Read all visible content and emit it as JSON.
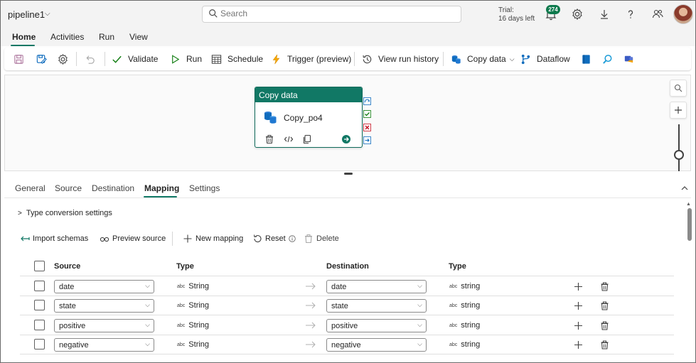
{
  "app": {
    "title": "pipeline1"
  },
  "search": {
    "placeholder": "Search"
  },
  "trial": {
    "line1": "Trial:",
    "line2": "16 days left"
  },
  "notifications": {
    "count": "274"
  },
  "menu": {
    "tabs": [
      "Home",
      "Activities",
      "Run",
      "View"
    ],
    "active": "Home"
  },
  "toolbar": {
    "validate": "Validate",
    "run": "Run",
    "schedule": "Schedule",
    "trigger": "Trigger (preview)",
    "view_run_history": "View run history",
    "copy_data": "Copy data",
    "dataflow": "Dataflow"
  },
  "activity": {
    "type": "Copy data",
    "name": "Copy_po4"
  },
  "panel": {
    "tabs": [
      "General",
      "Source",
      "Destination",
      "Mapping",
      "Settings"
    ],
    "active": "Mapping",
    "type_conversion": "Type conversion settings",
    "actions": {
      "import_schemas": "Import schemas",
      "preview_source": "Preview source",
      "new_mapping": "New mapping",
      "reset": "Reset",
      "delete": "Delete"
    }
  },
  "mapping": {
    "headers": {
      "source": "Source",
      "source_type": "Type",
      "destination": "Destination",
      "dest_type": "Type"
    },
    "abc": "abc",
    "rows": [
      {
        "source": "date",
        "source_type": "String",
        "destination": "date",
        "dest_type": "string"
      },
      {
        "source": "state",
        "source_type": "String",
        "destination": "state",
        "dest_type": "string"
      },
      {
        "source": "positive",
        "source_type": "String",
        "destination": "positive",
        "dest_type": "string"
      },
      {
        "source": "negative",
        "source_type": "String",
        "destination": "negative",
        "dest_type": "string"
      }
    ]
  },
  "colors": {
    "accent": "#117865",
    "brand_blue": "#0f6cbd",
    "failure": "#c50f1f"
  }
}
